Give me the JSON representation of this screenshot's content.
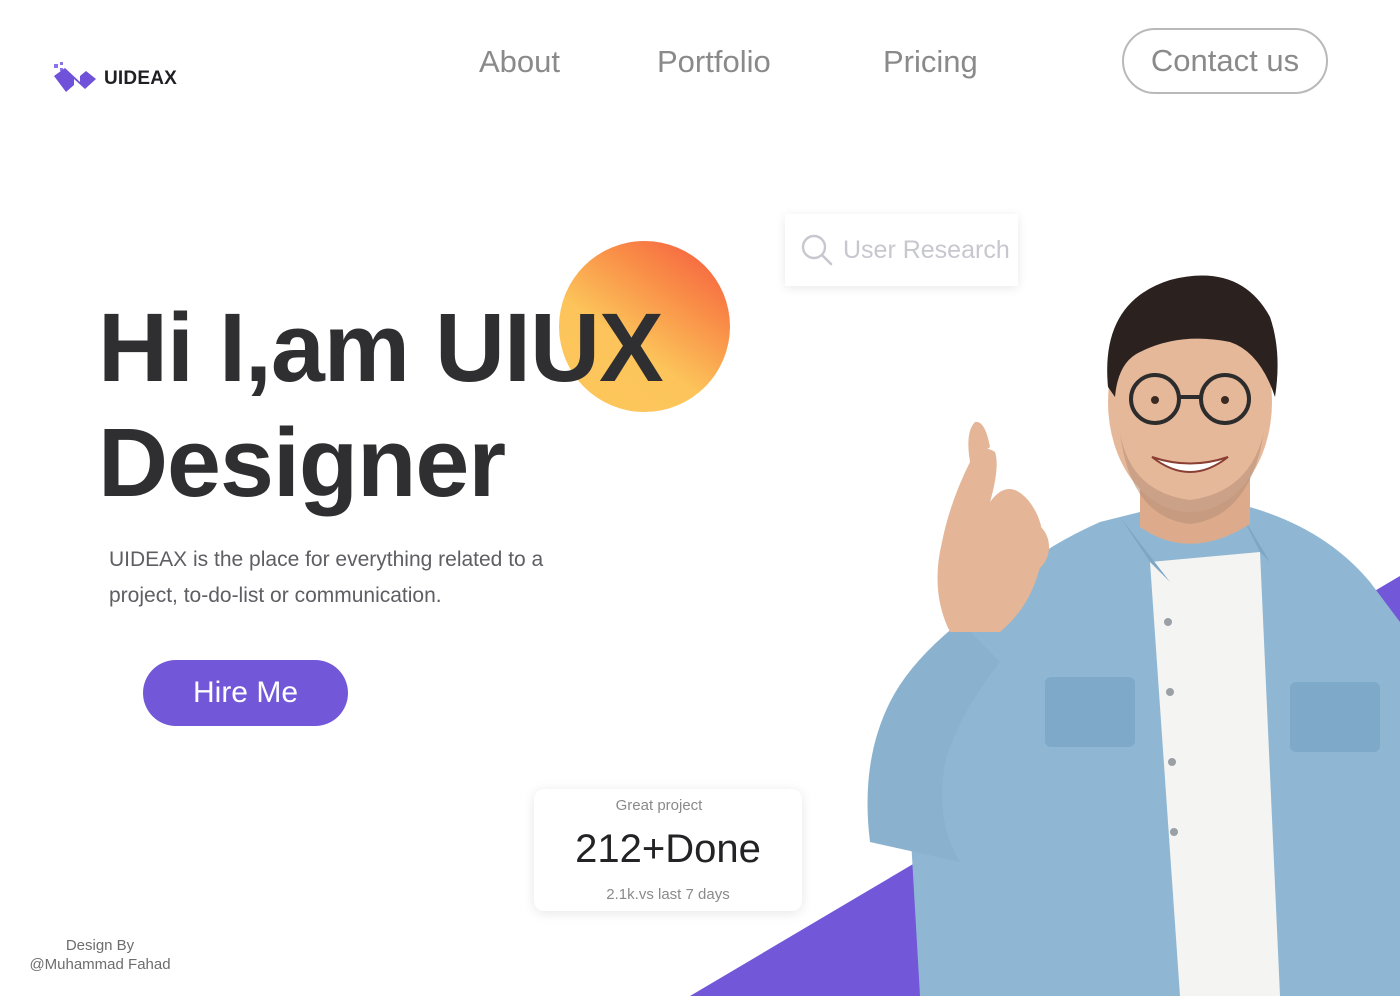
{
  "brand": {
    "name": "UIDEAX",
    "logo_color": "#6f52d9"
  },
  "nav": {
    "items": [
      "About",
      "Portfolio",
      "Pricing"
    ],
    "contact_label": "Contact us"
  },
  "search": {
    "placeholder": "User Research"
  },
  "hero": {
    "title_line1": "Hi I,am UIUX",
    "title_line2": "Designer",
    "description": "UIDEAX is the place for everything related to a project, to-do-list or communication.",
    "cta_label": "Hire Me"
  },
  "stats": {
    "label": "Great project",
    "value": "212+Done",
    "sub": "2.1k.vs last 7 days"
  },
  "credit": {
    "line1": "Design By",
    "line2": "@Muhammad Fahad"
  },
  "colors": {
    "accent": "#7257d8",
    "title_text": "#2f2f32",
    "nav_text": "#8a8a8a",
    "sun_start": "#f4553f",
    "sun_end": "#fec75c"
  },
  "icons": {
    "search": "search-icon",
    "logo": "uideax-logo-icon"
  }
}
